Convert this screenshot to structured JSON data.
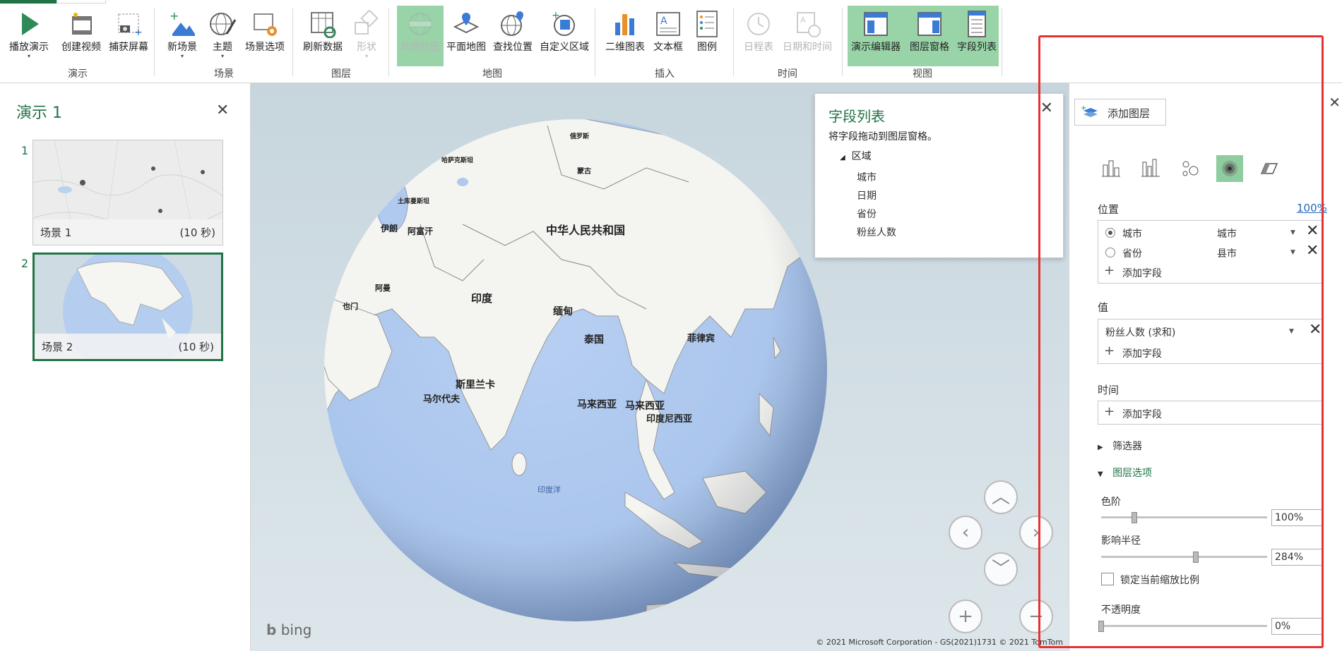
{
  "ribbon": {
    "groups": [
      {
        "label": "演示",
        "buttons": [
          {
            "label": "播放演示"
          },
          {
            "label": "创建视频"
          },
          {
            "label": "捕获屏幕"
          }
        ]
      },
      {
        "label": "场景",
        "buttons": [
          {
            "label": "新场景"
          },
          {
            "label": "主题"
          },
          {
            "label": "场景选项"
          }
        ]
      },
      {
        "label": "图层",
        "buttons": [
          {
            "label": "刷新数据"
          },
          {
            "label": "形状"
          }
        ]
      },
      {
        "label": "地图",
        "buttons": [
          {
            "label": "地图标签"
          },
          {
            "label": "平面地图"
          },
          {
            "label": "查找位置"
          },
          {
            "label": "自定义区域"
          }
        ]
      },
      {
        "label": "插入",
        "buttons": [
          {
            "label": "二维图表"
          },
          {
            "label": "文本框"
          },
          {
            "label": "图例"
          }
        ]
      },
      {
        "label": "时间",
        "buttons": [
          {
            "label": "日程表"
          },
          {
            "label": "日期和时间"
          }
        ]
      },
      {
        "label": "视图",
        "buttons": [
          {
            "label": "演示编辑器"
          },
          {
            "label": "图层窗格"
          },
          {
            "label": "字段列表"
          }
        ]
      }
    ]
  },
  "tour": {
    "title": "演示 1",
    "close": "✕",
    "scenes": [
      {
        "num": "1",
        "label": "场景 1",
        "duration": "(10 秒)"
      },
      {
        "num": "2",
        "label": "场景 2",
        "duration": "(10 秒)"
      }
    ]
  },
  "map": {
    "labels": {
      "china": "中华人民共和国",
      "india": "印度",
      "myanmar": "缅甸",
      "thailand": "泰国",
      "srilanka": "斯里兰卡",
      "maldives": "马尔代夫",
      "malaysia1": "马来西亚",
      "malaysia2": "马来西亚",
      "indonesia": "印度尼西亚",
      "philippines": "菲律宾",
      "afghanistan": "阿富汗",
      "iran": "伊朗",
      "oman": "阿曼",
      "yemen": "也门",
      "mongolia": "蒙古",
      "kazakhstan": "哈萨克斯坦",
      "turkmenistan": "土库曼斯坦",
      "russia": "俄罗斯",
      "ocean_label": "印度洋"
    },
    "bing": "bing",
    "copyright": "© 2021 Microsoft Corporation - GS(2021)1731  © 2021 TomTom"
  },
  "field_list": {
    "title": "字段列表",
    "hint": "将字段拖动到图层窗格。",
    "table": "区域",
    "fields": [
      "城市",
      "日期",
      "省份",
      "粉丝人数"
    ]
  },
  "layer_pane": {
    "add_layer": "添加图层",
    "close": "✕",
    "viz_icons": [
      "stacked-column-icon",
      "clustered-column-icon",
      "bubble-icon",
      "heatmap-icon",
      "region-icon"
    ],
    "position": {
      "title": "位置",
      "percent": "100%",
      "rows": [
        {
          "field": "城市",
          "type": "城市",
          "selected": true
        },
        {
          "field": "省份",
          "type": "县市",
          "selected": false
        }
      ],
      "add_field": "添加字段"
    },
    "value": {
      "title": "值",
      "field": "粉丝人数 (求和)",
      "add_field": "添加字段"
    },
    "time": {
      "title": "时间",
      "add_field": "添加字段"
    },
    "filters": "筛选器",
    "layer_options": "图层选项",
    "color_scale": {
      "label": "色阶",
      "value": "100%",
      "level": 0.2
    },
    "radius": {
      "label": "影响半径",
      "value": "284%",
      "level": 0.57
    },
    "lock_scale": "锁定当前缩放比例",
    "opacity": {
      "label": "不透明度",
      "value": "0%",
      "level": 0.0
    }
  },
  "colors": {
    "accent": "#217346",
    "active_bg": "#98d4a8",
    "annotation": "#e63232"
  }
}
